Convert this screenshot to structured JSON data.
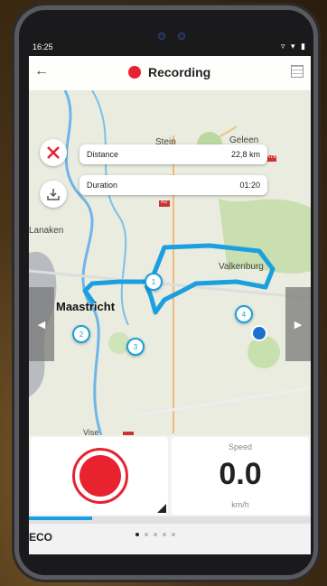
{
  "statusbar": {
    "time": "16:25",
    "icons": "▿ ▾ ▮"
  },
  "topbar": {
    "title": "Recording",
    "back_icon": "arrow-left-icon",
    "menu_icon": "grid-icon",
    "accent": "#e8222f"
  },
  "stats": {
    "distance_label": "Distance",
    "distance_value": "22,8 km",
    "duration_label": "Duration",
    "duration_value": "01:20"
  },
  "map": {
    "places": [
      "Stein",
      "Geleen",
      "Lanaken",
      "Maastricht",
      "Valkenburg",
      "Vise",
      "A2",
      "A76"
    ],
    "waypoints": [
      "1",
      "2",
      "3",
      "4"
    ],
    "route_color": "#1aa0e0"
  },
  "speed": {
    "label": "Speed",
    "value": "0.0",
    "unit": "km/h"
  },
  "bottom": {
    "mode_label": "ECO",
    "page_count": 5,
    "active_page": 0
  }
}
